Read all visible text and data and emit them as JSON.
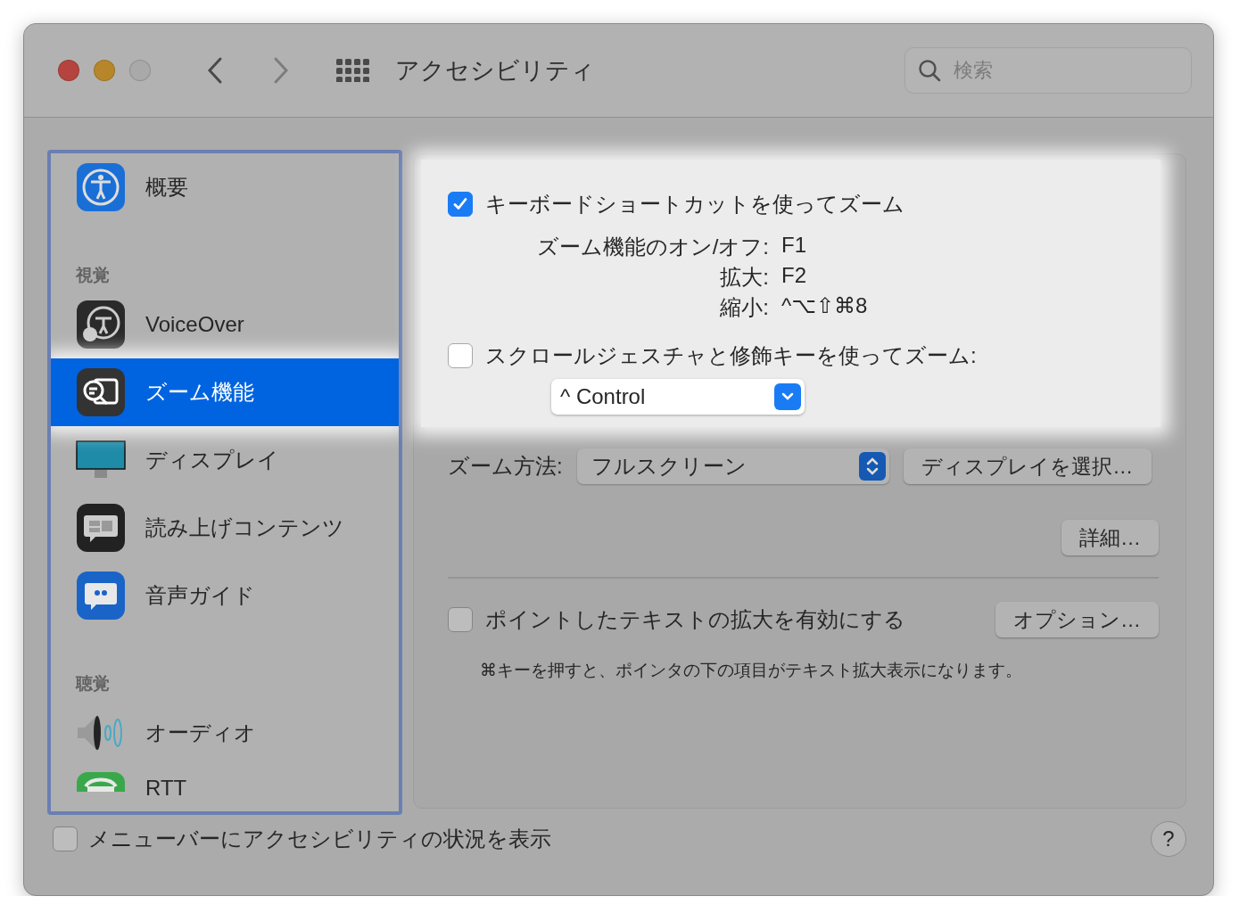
{
  "window": {
    "title": "アクセシビリティ"
  },
  "search": {
    "placeholder": "検索"
  },
  "sidebar": {
    "items": [
      {
        "kind": "item",
        "label": "概要",
        "selected": false
      },
      {
        "kind": "section",
        "label": "視覚"
      },
      {
        "kind": "item",
        "label": "VoiceOver",
        "selected": false
      },
      {
        "kind": "item",
        "label": "ズーム機能",
        "selected": true
      },
      {
        "kind": "item",
        "label": "ディスプレイ",
        "selected": false
      },
      {
        "kind": "item",
        "label": "読み上げコンテンツ",
        "selected": false
      },
      {
        "kind": "item",
        "label": "音声ガイド",
        "selected": false
      },
      {
        "kind": "section",
        "label": "聴覚"
      },
      {
        "kind": "item",
        "label": "オーディオ",
        "selected": false
      },
      {
        "kind": "item",
        "label": "RTT",
        "selected": false
      }
    ]
  },
  "zoom": {
    "keyboard_shortcuts": {
      "label": "キーボードショートカットを使ってズーム",
      "checked": true,
      "shortcuts": [
        {
          "label": "ズーム機能のオン/オフ:",
          "value": "F1"
        },
        {
          "label": "拡大:",
          "value": "F2"
        },
        {
          "label": "縮小:",
          "value": "^⌥⇧⌘8"
        }
      ]
    },
    "scroll_gesture": {
      "label": "スクロールジェスチャと修飾キーを使ってズーム:",
      "checked": false,
      "modifier": "^ Control"
    },
    "zoom_style": {
      "label": "ズーム方法:",
      "value": "フルスクリーン",
      "button": "ディスプレイを選択…"
    },
    "advanced_button": "詳細…",
    "hover_text": {
      "label": "ポイントしたテキストの拡大を有効にする",
      "checked": false,
      "button": "オプション…",
      "note": "⌘キーを押すと、ポインタの下の項目がテキスト拡大表示になります。"
    }
  },
  "footer": {
    "menu_bar_status": {
      "label": "メニューバーにアクセシビリティの状況を表示",
      "checked": false
    },
    "help": "?"
  }
}
